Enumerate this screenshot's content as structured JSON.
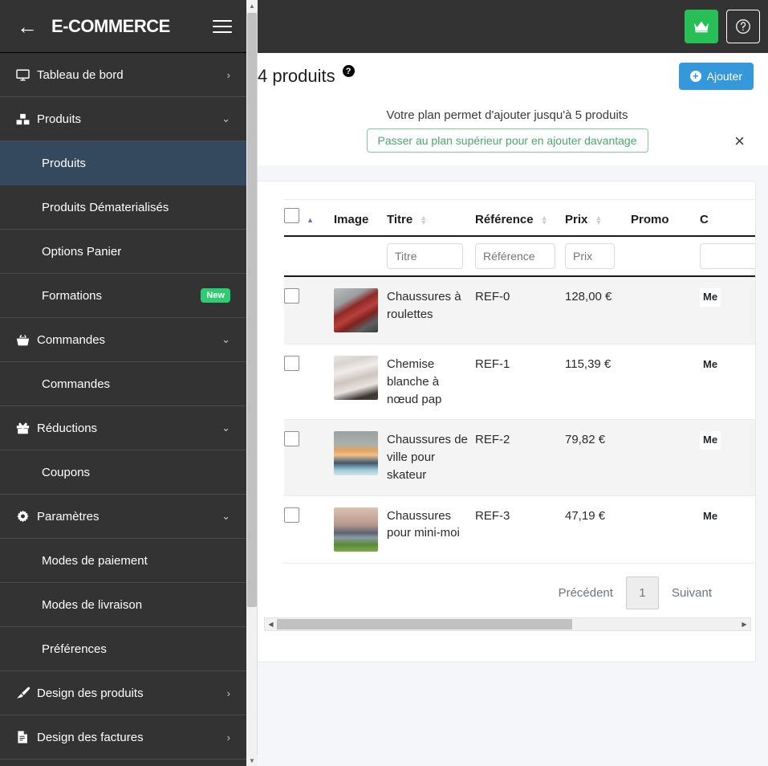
{
  "sidebar": {
    "brand": "E-COMMERCE",
    "back_icon": "arrow-left-icon",
    "menu_icon": "hamburger-icon",
    "items": [
      {
        "label": "Tableau de bord",
        "icon": "desktop-icon",
        "caret": "›",
        "level": "top",
        "active": false
      },
      {
        "label": "Produits",
        "icon": "boxes-icon",
        "caret": "⌄",
        "level": "top",
        "active": false
      },
      {
        "label": "Produits",
        "icon": "",
        "caret": "",
        "level": "sub",
        "active": true
      },
      {
        "label": "Produits Dématerialisés",
        "icon": "",
        "caret": "",
        "level": "sub",
        "active": false
      },
      {
        "label": "Options Panier",
        "icon": "",
        "caret": "",
        "level": "sub",
        "active": false
      },
      {
        "label": "Formations",
        "icon": "",
        "caret": "",
        "level": "sub",
        "active": false,
        "badge": "New"
      },
      {
        "label": "Commandes",
        "icon": "basket-icon",
        "caret": "⌄",
        "level": "top",
        "active": false
      },
      {
        "label": "Commandes",
        "icon": "",
        "caret": "",
        "level": "sub",
        "active": false
      },
      {
        "label": "Réductions",
        "icon": "gift-icon",
        "caret": "⌄",
        "level": "top",
        "active": false
      },
      {
        "label": "Coupons",
        "icon": "",
        "caret": "",
        "level": "sub",
        "active": false
      },
      {
        "label": "Paramètres",
        "icon": "gear-icon",
        "caret": "⌄",
        "level": "top",
        "active": false
      },
      {
        "label": "Modes de paiement",
        "icon": "",
        "caret": "",
        "level": "sub",
        "active": false
      },
      {
        "label": "Modes de livraison",
        "icon": "",
        "caret": "",
        "level": "sub",
        "active": false
      },
      {
        "label": "Préférences",
        "icon": "",
        "caret": "",
        "level": "sub",
        "active": false
      },
      {
        "label": "Design des produits",
        "icon": "brush-icon",
        "caret": "›",
        "level": "top",
        "active": false
      },
      {
        "label": "Design des factures",
        "icon": "invoice-icon",
        "caret": "›",
        "level": "top",
        "active": false
      }
    ]
  },
  "topbar": {
    "crown_icon": "crown-icon",
    "help_icon": "question-circle-icon"
  },
  "pagehead": {
    "title": "4 produits",
    "help_badge": "?",
    "add_label": "Ajouter",
    "add_icon": "plus-circle-icon"
  },
  "alert": {
    "text": "Votre plan permet d'ajouter jusqu'à 5 produits",
    "button": "Passer au plan supérieur pour en ajouter davantage",
    "close_icon": "×"
  },
  "table": {
    "columns": [
      {
        "key": "check",
        "label": ""
      },
      {
        "key": "image",
        "label": "Image"
      },
      {
        "key": "titre",
        "label": "Titre"
      },
      {
        "key": "reference",
        "label": "Référence"
      },
      {
        "key": "prix",
        "label": "Prix"
      },
      {
        "key": "promo",
        "label": "Promo"
      },
      {
        "key": "c",
        "label": "C"
      }
    ],
    "filters": {
      "titre_placeholder": "Titre",
      "reference_placeholder": "Référence",
      "prix_placeholder": "Prix"
    },
    "rows": [
      {
        "titre": "Chaussures à roulettes",
        "reference": "REF-0",
        "prix": "128,00 €",
        "promo": "",
        "c": "Me"
      },
      {
        "titre": "Chemise blanche à nœud pap",
        "reference": "REF-1",
        "prix": "115,39 €",
        "promo": "",
        "c": "Me"
      },
      {
        "titre": "Chaussures de ville pour skateur",
        "reference": "REF-2",
        "prix": "79,82 €",
        "promo": "",
        "c": "Me"
      },
      {
        "titre": "Chaussures pour mini-moi",
        "reference": "REF-3",
        "prix": "47,19 €",
        "promo": "",
        "c": "Me"
      }
    ]
  },
  "pagination": {
    "prev": "Précédent",
    "page": "1",
    "next": "Suivant"
  },
  "colors": {
    "sidebar_bg": "#333333",
    "sidebar_active": "#34495e",
    "accent_blue": "#3498db",
    "accent_green": "#27c057",
    "badge_green": "#2ecc71",
    "page_bg": "#f4f6f9"
  }
}
